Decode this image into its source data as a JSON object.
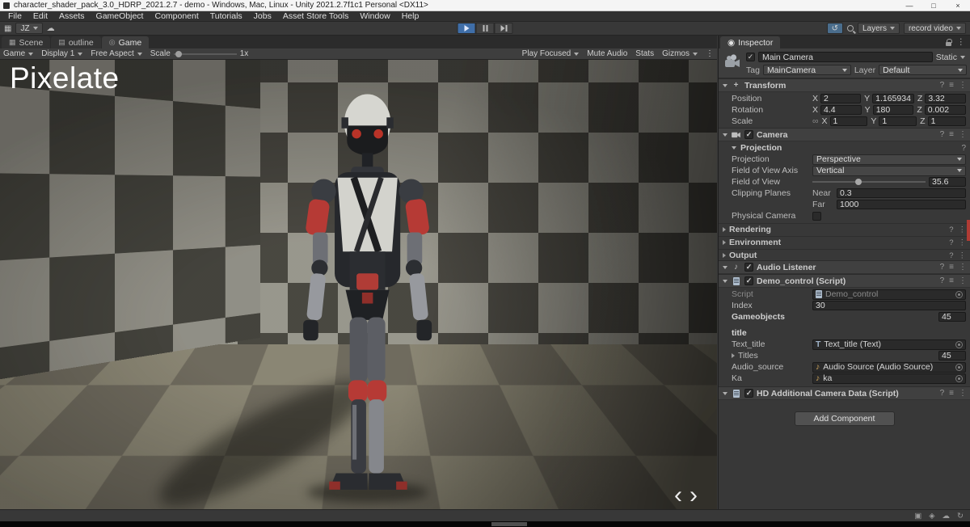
{
  "window": {
    "title": "character_shader_pack_3.0_HDRP_2021.2.7 - demo - Windows, Mac, Linux - Unity 2021.2.7f1c1 Personal <DX11>"
  },
  "menu": {
    "items": [
      "File",
      "Edit",
      "Assets",
      "GameObject",
      "Component",
      "Tutorials",
      "Jobs",
      "Asset Store Tools",
      "Window",
      "Help"
    ]
  },
  "toolbar": {
    "account": "JZ",
    "layers": "Layers",
    "layout": "record video"
  },
  "tabs": {
    "scene": "Scene",
    "outline": "outline",
    "game": "Game"
  },
  "game_toolbar": {
    "game": "Game",
    "display": "Display 1",
    "aspect": "Free Aspect",
    "scale_label": "Scale",
    "scale_value": "1x",
    "play_focused": "Play Focused",
    "mute_audio": "Mute Audio",
    "stats": "Stats",
    "gizmos": "Gizmos"
  },
  "game_view": {
    "overlay_title": "Pixelate"
  },
  "inspector": {
    "tab": "Inspector",
    "header": {
      "name": "Main Camera",
      "static_label": "Static",
      "tag_label": "Tag",
      "tag_value": "MainCamera",
      "layer_label": "Layer",
      "layer_value": "Default"
    },
    "transform": {
      "title": "Transform",
      "position_label": "Position",
      "rotation_label": "Rotation",
      "scale_label": "Scale",
      "axis_x": "X",
      "axis_y": "Y",
      "axis_z": "Z",
      "position": {
        "x": "2",
        "y": "1.165934",
        "z": "3.32"
      },
      "rotation": {
        "x": "4.4",
        "y": "180",
        "z": "0.002"
      },
      "scale": {
        "x": "1",
        "y": "1",
        "z": "1"
      }
    },
    "camera": {
      "title": "Camera",
      "projection_section": "Projection",
      "projection_label": "Projection",
      "projection_value": "Perspective",
      "fov_axis_label": "Field of View Axis",
      "fov_axis_value": "Vertical",
      "fov_label": "Field of View",
      "fov_value": "35.6",
      "clipping_label": "Clipping Planes",
      "near_label": "Near",
      "near_value": "0.3",
      "far_label": "Far",
      "far_value": "1000",
      "physical_label": "Physical Camera",
      "rendering": "Rendering",
      "environment": "Environment",
      "output": "Output"
    },
    "audio_listener": {
      "title": "Audio Listener"
    },
    "demo_control": {
      "title": "Demo_control (Script)",
      "script_label": "Script",
      "script_value": "Demo_control",
      "index_label": "Index",
      "index_value": "30",
      "gameobjects_label": "Gameobjects",
      "gameobjects_value": "45",
      "section_title": "title",
      "text_title_label": "Text_title",
      "text_title_value": "Text_title (Text)",
      "titles_label": "Titles",
      "titles_value": "45",
      "audio_source_label": "Audio_source",
      "audio_source_value": "Audio Source (Audio Source)",
      "ka_label": "Ka",
      "ka_value": "ka"
    },
    "hd_camera": {
      "title": "HD Additional Camera Data (Script)"
    },
    "add_component": "Add Component"
  },
  "icons": {
    "check": "✓",
    "kebab": "⋮",
    "help": "?",
    "preset": "≡",
    "minimize": "—",
    "maximize": "□",
    "close": "×",
    "cloud": "☁",
    "history": "↺",
    "note": "♪",
    "link": "∞",
    "nav_left": "‹",
    "nav_right": "›",
    "grid": "▦",
    "scene_tab": "▦",
    "outline_tab": "▤",
    "game_tab": "◎",
    "inspector_tab": "◉",
    "status_1": "▣",
    "status_2": "◈",
    "status_3": "☁",
    "status_4": "↻",
    "text_comp": "T"
  }
}
